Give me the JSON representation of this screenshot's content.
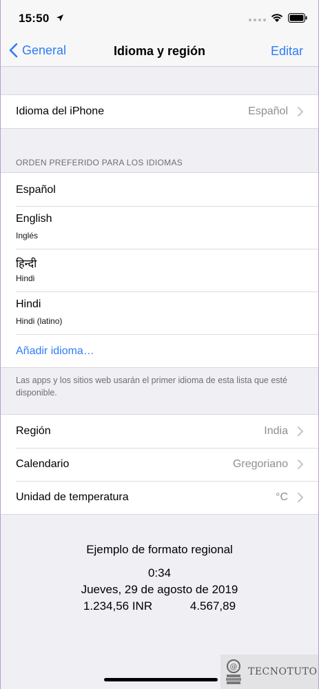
{
  "status": {
    "time": "15:50"
  },
  "nav": {
    "back_label": "General",
    "title": "Idioma y región",
    "edit_label": "Editar"
  },
  "iphone_language": {
    "label": "Idioma del iPhone",
    "value": "Español"
  },
  "preferred": {
    "header": "ORDEN PREFERIDO PARA LOS IDIOMAS",
    "languages": [
      {
        "name": "Español"
      },
      {
        "name": "English",
        "sub": "Inglés"
      },
      {
        "name": "हिन्दी",
        "sub": "Hindi"
      },
      {
        "name": "Hindi",
        "sub": "Hindi (latino)"
      }
    ],
    "add_label": "Añadir idioma…",
    "footer": "Las apps y los sitios web usarán el primer idioma de esta lista que esté disponible."
  },
  "region_settings": [
    {
      "label": "Región",
      "value": "India"
    },
    {
      "label": "Calendario",
      "value": "Gregoriano"
    },
    {
      "label": "Unidad de temperatura",
      "value": "°C"
    }
  ],
  "format_example": {
    "title": "Ejemplo de formato regional",
    "time": "0:34",
    "date": "Jueves, 29 de agosto de 2019",
    "currency": "1.234,56 INR",
    "number": "4.567,89"
  },
  "watermark": {
    "text": "TECNOTUTO"
  },
  "colors": {
    "accent": "#2d7cf6",
    "background": "#efeff4",
    "secondary_text": "#8e8e93"
  },
  "icons": [
    "location-arrow-icon",
    "wifi-icon",
    "battery-icon",
    "chevron-left-icon",
    "chevron-right-icon",
    "tecnotuto-logo-icon"
  ]
}
